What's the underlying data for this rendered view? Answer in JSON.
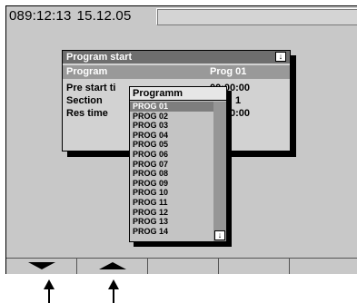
{
  "status": {
    "time": "089:12:13",
    "date": "15.12.05"
  },
  "dialog": {
    "title": "Program start",
    "title_dropdown_icon": "arrow-down-icon",
    "rows": [
      {
        "label": "Program",
        "value": "Prog 01"
      },
      {
        "label": "Pre start ti",
        "value": "00:00:00"
      },
      {
        "label": "Section",
        "value": "1"
      },
      {
        "label": "Res time",
        "value": "00:00:00"
      }
    ]
  },
  "program_list": {
    "title": "Programm",
    "selected_index": 0,
    "items": [
      "PROG  01",
      "PROG  02",
      "PROG  03",
      "PROG  04",
      "PROG  05",
      "PROG  06",
      "PROG  07",
      "PROG  08",
      "PROG  09",
      "PROG  10",
      "PROG  11",
      "PROG  12",
      "PROG  13",
      "PROG  14"
    ],
    "scroll_icon": "arrow-down-icon"
  },
  "softkeys": [
    {
      "icon": "triangle-down-icon"
    },
    {
      "icon": "triangle-up-icon"
    },
    {
      "icon": ""
    },
    {
      "icon": ""
    },
    {
      "icon": ""
    }
  ],
  "colors": {
    "screen": "#c8c8c8",
    "highlight": "#7e7e7e",
    "title_bar": "#6e6e6e"
  }
}
